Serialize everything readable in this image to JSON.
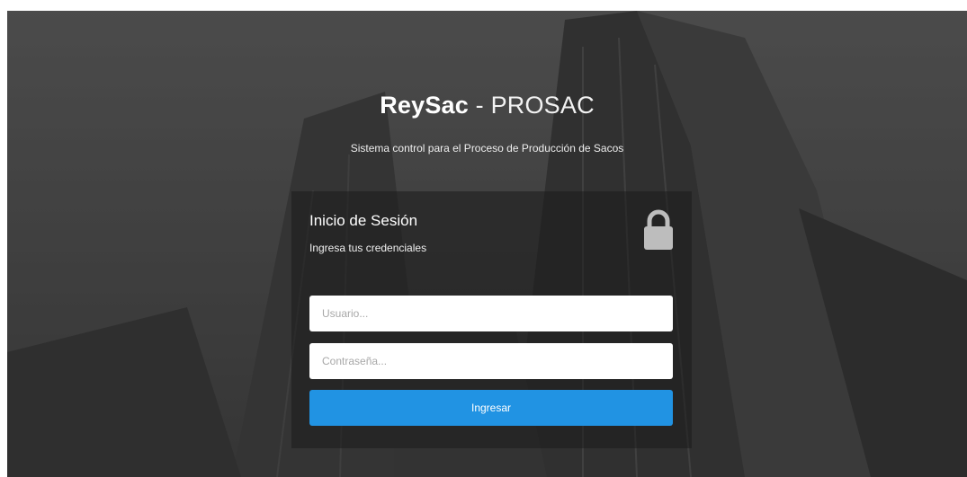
{
  "header": {
    "brand_strong": "ReySac",
    "brand_rest": " - PROSAC",
    "tagline": "Sistema control para el Proceso de Producción de Sacos"
  },
  "login": {
    "title": "Inicio de Sesión",
    "subtitle": "Ingresa tus credenciales",
    "lock_icon": "lock-icon",
    "username": {
      "value": "",
      "placeholder": "Usuario..."
    },
    "password": {
      "value": "",
      "placeholder": "Contraseña..."
    },
    "submit_label": "Ingresar"
  },
  "colors": {
    "accent": "#2193e3",
    "background": "#4a4a4a",
    "panel": "#1c1c1c"
  }
}
